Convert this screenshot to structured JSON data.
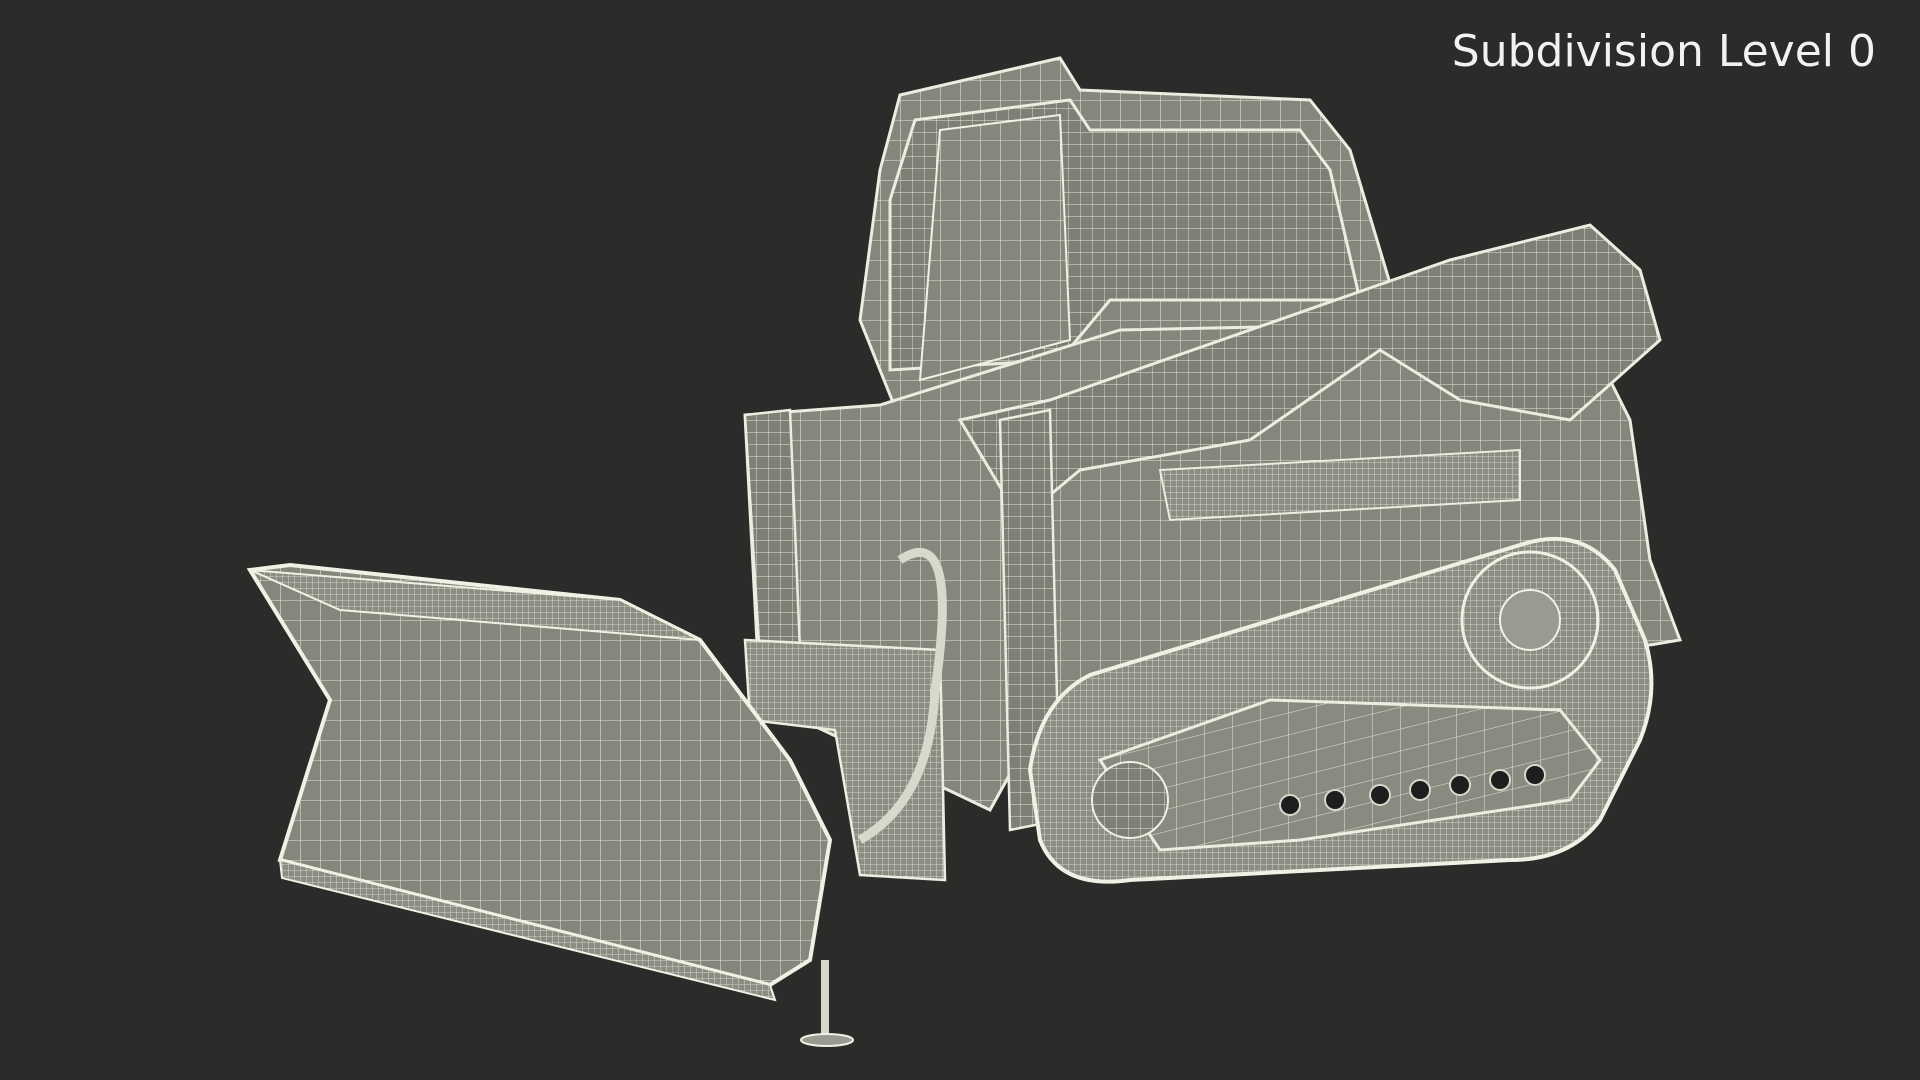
{
  "viewport": {
    "subdivision_label": "Subdivision Level 0",
    "background_color": "#2b2b2a"
  },
  "model": {
    "subject": "tracked-skid-steer-loader-with-snow-blade",
    "render_style": "wireframe-over-clay",
    "surface_color": "#8d8d83",
    "wire_color": "#e6e6dc"
  }
}
